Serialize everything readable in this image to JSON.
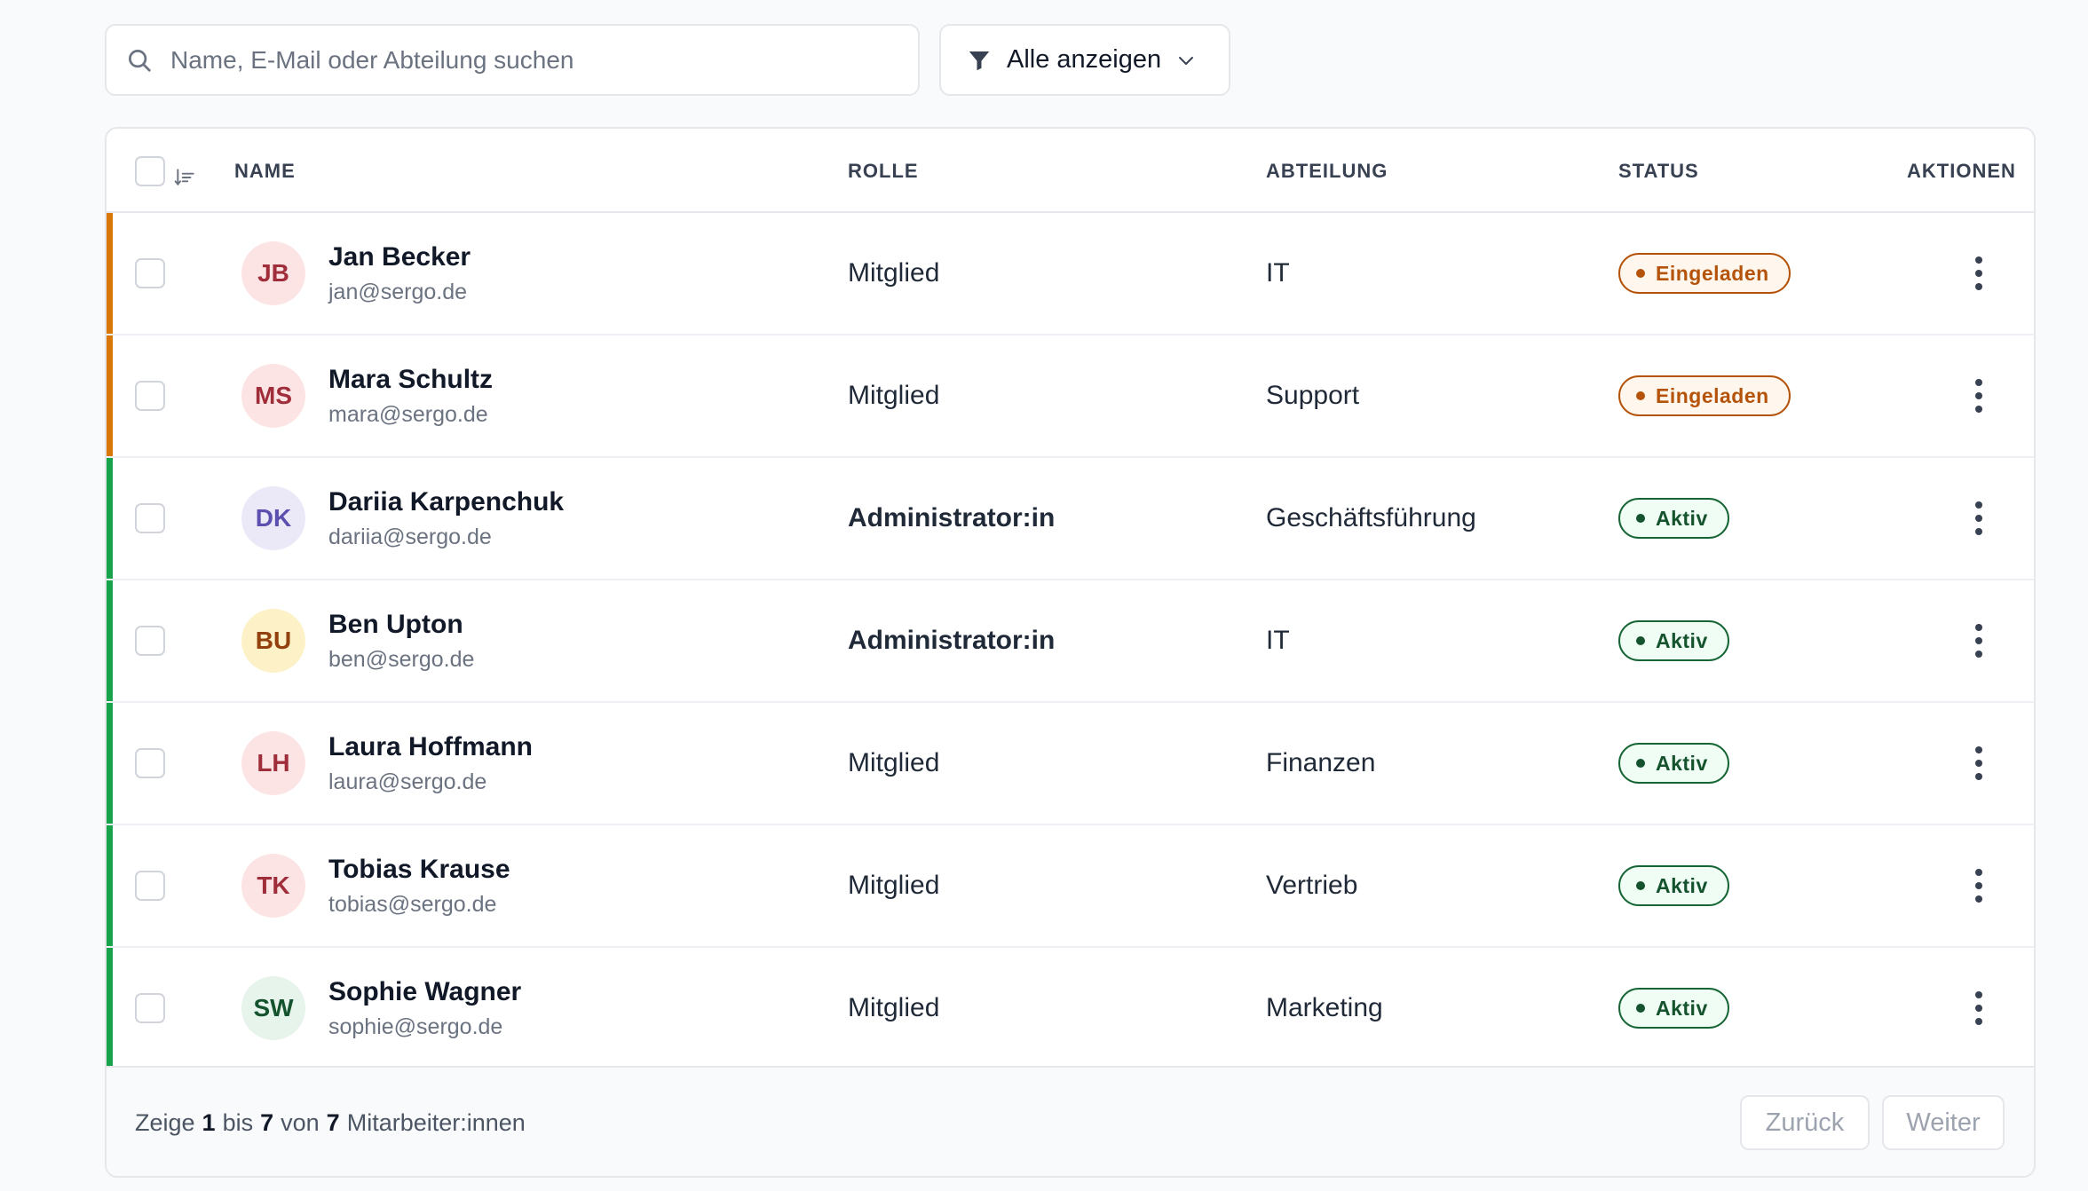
{
  "search": {
    "placeholder": "Name, E-Mail oder Abteilung suchen",
    "value": ""
  },
  "filter": {
    "label": "Alle anzeigen",
    "icon": "filter-icon"
  },
  "table": {
    "headers": {
      "name": "NAME",
      "role": "ROLLE",
      "department": "ABTEILUNG",
      "status": "STATUS",
      "actions": "AKTIONEN"
    },
    "rows": [
      {
        "initials": "JB",
        "name": "Jan Becker",
        "email": "jan@sergo.de",
        "role": "Mitglied",
        "admin": false,
        "department": "IT",
        "status": "Eingeladen",
        "status_type": "invited",
        "avatar_bg": "#fde4e4",
        "avatar_fg": "#9f2d3a"
      },
      {
        "initials": "MS",
        "name": "Mara Schultz",
        "email": "mara@sergo.de",
        "role": "Mitglied",
        "admin": false,
        "department": "Support",
        "status": "Eingeladen",
        "status_type": "invited",
        "avatar_bg": "#fde4e4",
        "avatar_fg": "#9f2d3a"
      },
      {
        "initials": "DK",
        "name": "Dariia Karpenchuk",
        "email": "dariia@sergo.de",
        "role": "Administrator:in",
        "admin": true,
        "department": "Geschäftsführung",
        "status": "Aktiv",
        "status_type": "active",
        "avatar_bg": "#ebe8f7",
        "avatar_fg": "#5b4fb0"
      },
      {
        "initials": "BU",
        "name": "Ben Upton",
        "email": "ben@sergo.de",
        "role": "Administrator:in",
        "admin": true,
        "department": "IT",
        "status": "Aktiv",
        "status_type": "active",
        "avatar_bg": "#fdf1c7",
        "avatar_fg": "#92400e"
      },
      {
        "initials": "LH",
        "name": "Laura Hoffmann",
        "email": "laura@sergo.de",
        "role": "Mitglied",
        "admin": false,
        "department": "Finanzen",
        "status": "Aktiv",
        "status_type": "active",
        "avatar_bg": "#fde4e4",
        "avatar_fg": "#9f2d3a"
      },
      {
        "initials": "TK",
        "name": "Tobias Krause",
        "email": "tobias@sergo.de",
        "role": "Mitglied",
        "admin": false,
        "department": "Vertrieb",
        "status": "Aktiv",
        "status_type": "active",
        "avatar_bg": "#fde4e4",
        "avatar_fg": "#9f2d3a"
      },
      {
        "initials": "SW",
        "name": "Sophie Wagner",
        "email": "sophie@sergo.de",
        "role": "Mitglied",
        "admin": false,
        "department": "Marketing",
        "status": "Aktiv",
        "status_type": "active",
        "avatar_bg": "#e6f4ec",
        "avatar_fg": "#14532d"
      }
    ]
  },
  "status_colors": {
    "invited": {
      "accent": "#d97706",
      "border": "#b45309",
      "text": "#b45309",
      "bg": "#fff7ed",
      "dot": "#b45309"
    },
    "active": {
      "accent": "#16a34a",
      "border": "#166534",
      "text": "#14532d",
      "bg": "#f0fdf4",
      "dot": "#14532d"
    }
  },
  "footer": {
    "prefix": "Zeige",
    "from": "1",
    "to_word": "bis",
    "to": "7",
    "of_word": "von",
    "total": "7",
    "suffix": "Mitarbeiter:innen",
    "prev_label": "Zurück",
    "next_label": "Weiter"
  }
}
